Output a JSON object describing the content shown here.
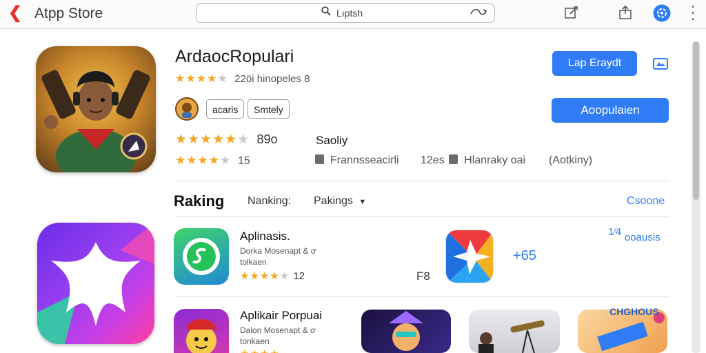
{
  "topbar": {
    "back_glyph": "❮",
    "title": "Atpp Store",
    "search_placeholder": "Lıptsh",
    "icons": [
      "back-icon",
      "search-icon",
      "edit-icon",
      "share-icon",
      "account-icon",
      "more-icon"
    ]
  },
  "hero": {
    "name": "ArdaocRopulari",
    "rating_stars": 3.5,
    "rating_meta": "22öi hinopeles 8",
    "tags": [
      "acaris",
      "Smtely"
    ],
    "rating2_value": "89o",
    "rating2_stars": 4.5,
    "label_right": "Saoliy",
    "rating3_value": "15",
    "rating3_stars": 3.5,
    "info1": "Frannsseacirli",
    "info2_prefix": "12es",
    "info2": "Hlanraky oai",
    "info3": "(Aotkiny)",
    "btn_small": "Lap Eraydt",
    "btn_big": "Aoopulaien",
    "colors": {
      "accent": "#2f7cf6",
      "star": "#f5a623"
    }
  },
  "ranking": {
    "title": "Raking",
    "label1": "Nanking:",
    "label2": "Pakings",
    "see_more": "Csoone",
    "side_top": "1⁄4",
    "side_label": "ooausis"
  },
  "rows": [
    {
      "title": "Aplinasis.",
      "sub1": "Dorka Mosenapt & ơ",
      "sub2": "tolkaen",
      "stars": 4.5,
      "count": "12",
      "extra_right": "F8",
      "extra_value": "+65"
    },
    {
      "title": "Aplikair Porpuai",
      "sub1": "Dalon Mosenapt & ơ",
      "sub2": "tonkaen",
      "stars": 4,
      "count": "",
      "tile_label": "CHGHOUS"
    }
  ]
}
